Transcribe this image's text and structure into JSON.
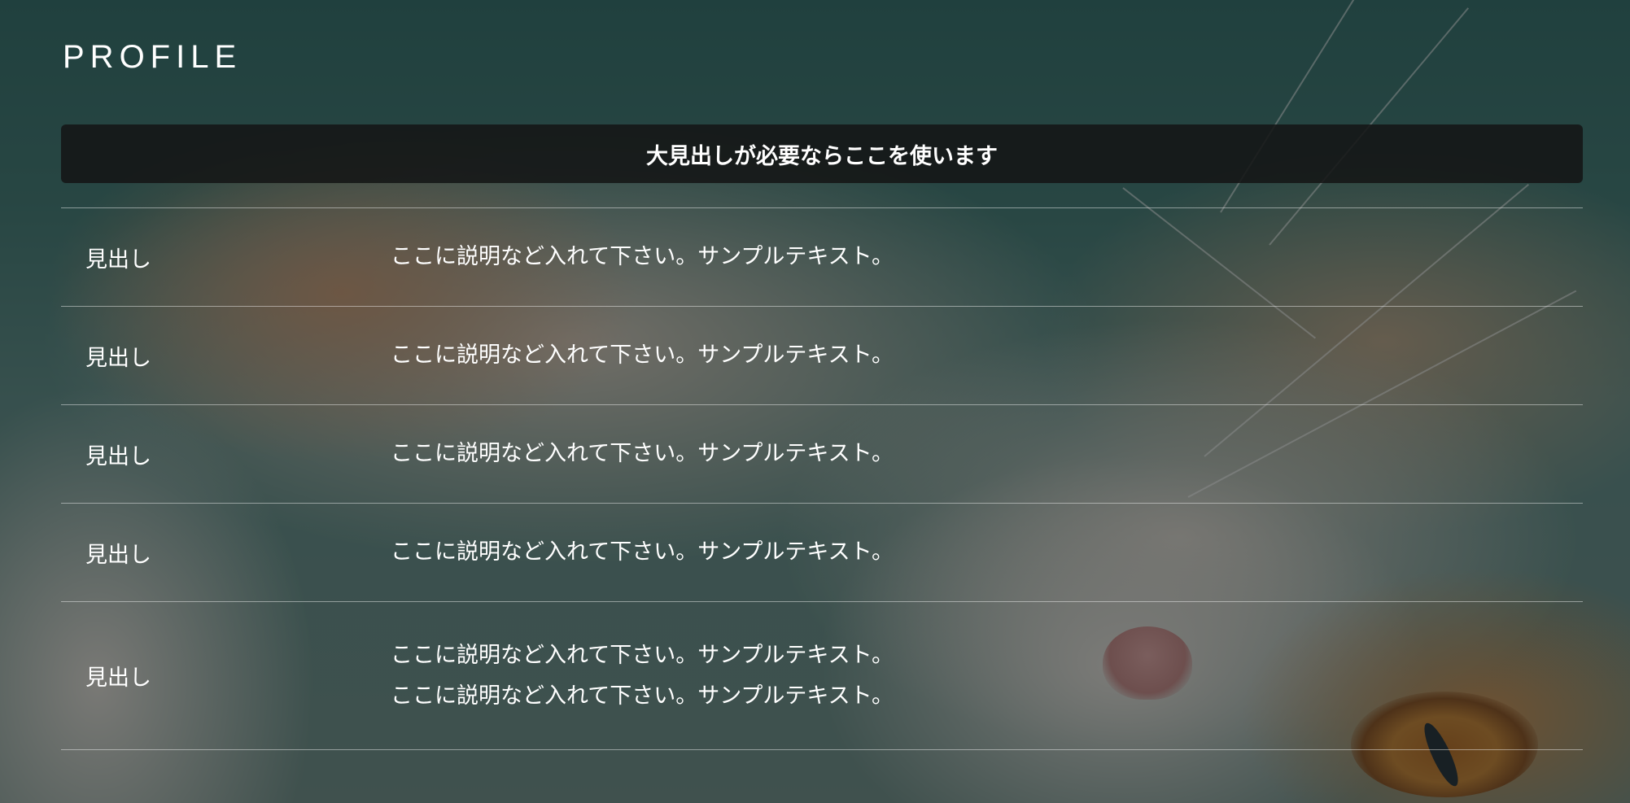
{
  "section": {
    "title": "PROFILE"
  },
  "heading_bar": {
    "text": "大見出しが必要ならここを使います"
  },
  "rows": [
    {
      "label": "見出し",
      "lines": [
        "ここに説明など入れて下さい。サンプルテキスト。"
      ]
    },
    {
      "label": "見出し",
      "lines": [
        "ここに説明など入れて下さい。サンプルテキスト。"
      ]
    },
    {
      "label": "見出し",
      "lines": [
        "ここに説明など入れて下さい。サンプルテキスト。"
      ]
    },
    {
      "label": "見出し",
      "lines": [
        "ここに説明など入れて下さい。サンプルテキスト。"
      ]
    },
    {
      "label": "見出し",
      "lines": [
        "ここに説明など入れて下さい。サンプルテキスト。",
        "ここに説明など入れて下さい。サンプルテキスト。"
      ]
    }
  ],
  "colors": {
    "text": "#ffffff",
    "heading_bar_bg": "#161818",
    "divider": "#8a8f8e"
  },
  "background": {
    "image": "blurred cat photo on teal background"
  }
}
